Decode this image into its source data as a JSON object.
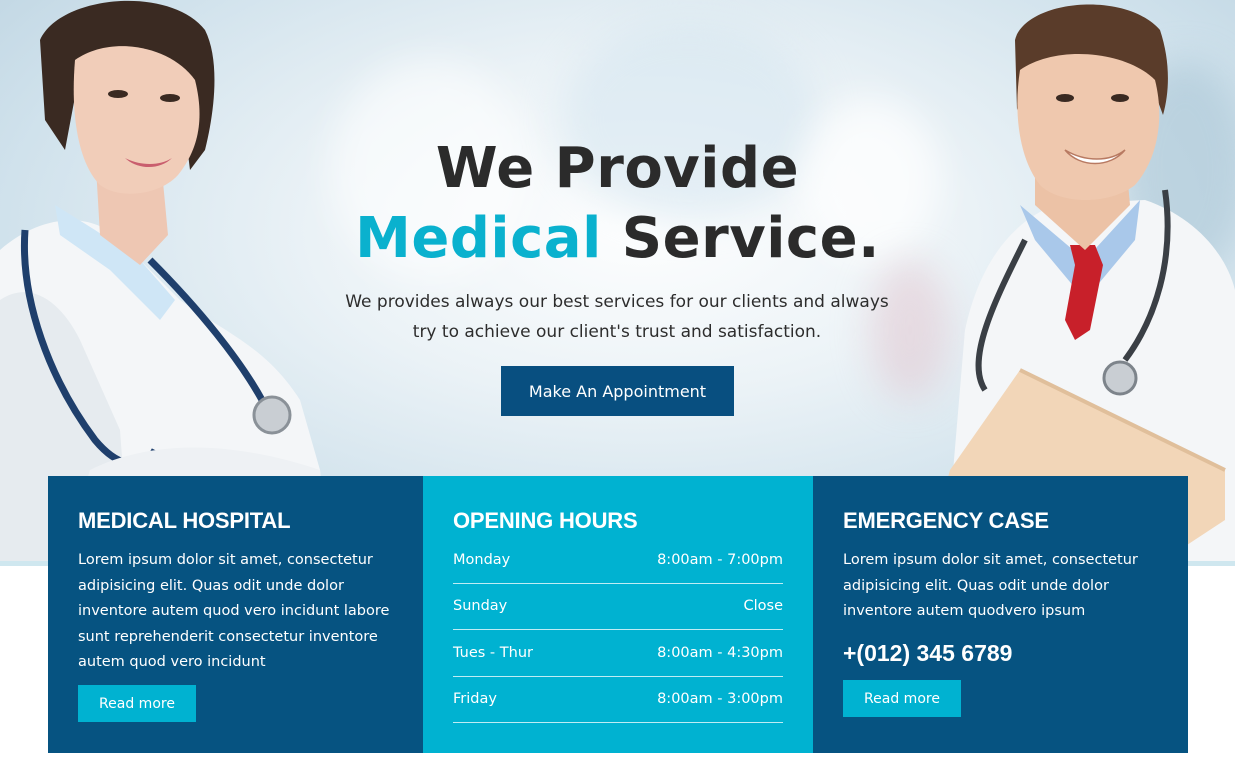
{
  "hero": {
    "title_line1": "We Provide",
    "title_accent": "Medical",
    "title_line2_rest": " Service.",
    "lead_line1": "We provides always our best services for our clients and always",
    "lead_line2": "try to achieve our client's trust and satisfaction.",
    "cta_label": "Make An Appointment"
  },
  "panels": {
    "hospital": {
      "title": "MEDICAL HOSPITAL",
      "text": "Lorem ipsum dolor sit amet, consectetur adipisicing elit. Quas odit unde dolor inventore autem quod vero incidunt labore sunt reprehenderit consectetur inventore autem quod vero incidunt",
      "button": "Read more"
    },
    "hours": {
      "title": "OPENING HOURS",
      "rows": [
        {
          "day": "Monday",
          "time": "8:00am - 7:00pm"
        },
        {
          "day": "Sunday",
          "time": "Close"
        },
        {
          "day": "Tues - Thur",
          "time": "8:00am - 4:30pm"
        },
        {
          "day": "Friday",
          "time": "8:00am - 3:00pm"
        }
      ]
    },
    "emergency": {
      "title": "EMERGENCY CASE",
      "text": "Lorem ipsum dolor sit amet, consectetur adipisicing elit. Quas odit unde dolor inventore autem quodvero ipsum",
      "phone": "+(012) 345 6789",
      "button": "Read more"
    }
  },
  "colors": {
    "accent": "#0ab1ce",
    "navy": "#065381",
    "cta": "#084f80",
    "cyan_panel": "#00b2d1"
  },
  "images": {
    "left": "female-doctor-photo",
    "right": "male-doctor-photo"
  }
}
